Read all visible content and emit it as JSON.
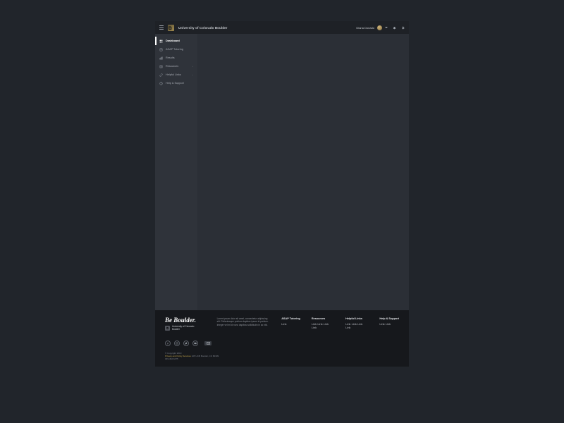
{
  "header": {
    "brand_prefix": "University of Colorado ",
    "brand_bold": "Boulder",
    "username": "Diana Donado"
  },
  "sidebar": {
    "items": [
      {
        "label": "Dashboard",
        "expandable": false
      },
      {
        "label": "ASAP Tutoring",
        "expandable": false
      },
      {
        "label": "Results",
        "expandable": false
      },
      {
        "label": "Resources",
        "expandable": true
      },
      {
        "label": "Helpful Links",
        "expandable": true
      },
      {
        "label": "Help & Support",
        "expandable": false
      }
    ]
  },
  "footer": {
    "beboulder": "Be Boulder.",
    "sublogo_line1": "University of Colorado",
    "sublogo_line2": "Boulder",
    "desc": "Lorem ipsum dolor sit amet, consectetur adipiscing elit. Pellentesque pretium dapibus ipsum id pretium. Integer vel mi id nunc dapibus sollicitudin in ac nisl.",
    "cols": [
      {
        "title": "ASAP Tutoring",
        "links": [
          "Link"
        ]
      },
      {
        "title": "Resources",
        "links": [
          "Link",
          "Link",
          "Link",
          "Link"
        ]
      },
      {
        "title": "Helpful Links",
        "links": [
          "Link",
          "Link",
          "Link",
          "Link"
        ]
      },
      {
        "title": "Help & Support",
        "links": [
          "Link",
          "Link"
        ]
      }
    ],
    "copyright": "© Copyright 2019",
    "policy_label": "Privacy and Policy Services",
    "address": " 105 UCB Boulder, CO 80309",
    "phone": "303-492-6475"
  }
}
